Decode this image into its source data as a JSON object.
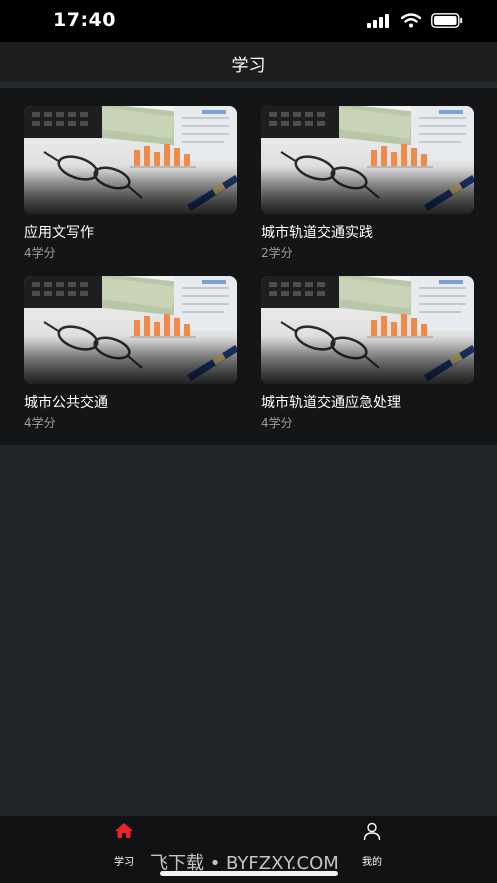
{
  "status": {
    "time": "17:40"
  },
  "header": {
    "title": "学习"
  },
  "courses": [
    {
      "title": "应用文写作",
      "credit": "4学分"
    },
    {
      "title": "城市轨道交通实践",
      "credit": "2学分"
    },
    {
      "title": "城市公共交通",
      "credit": "4学分"
    },
    {
      "title": "城市轨道交通应急处理",
      "credit": "4学分"
    }
  ],
  "tabs": [
    {
      "label": "学习",
      "icon": "home-icon",
      "active": true
    },
    {
      "label": "我的",
      "icon": "user-icon",
      "active": false
    }
  ],
  "watermark": "飞下载 • BYFZXY.COM",
  "colors": {
    "accent": "#e8262a",
    "background": "#212426",
    "panel": "#141516"
  }
}
